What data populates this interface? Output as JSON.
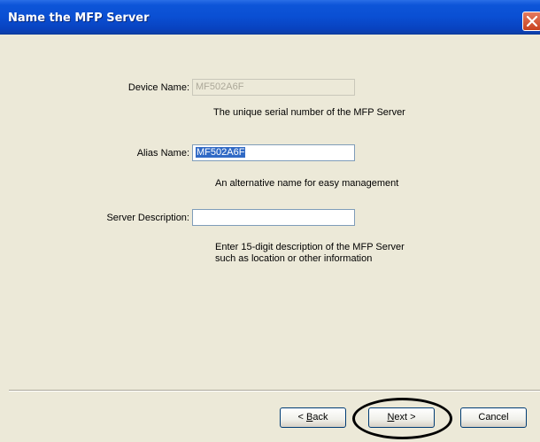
{
  "window": {
    "title": "Name the MFP Server",
    "close_icon": "close-icon"
  },
  "form": {
    "device_name": {
      "label": "Device Name:",
      "value": "MF502A6F",
      "hint": "The unique serial number of the MFP Server"
    },
    "alias_name": {
      "label": "Alias Name:",
      "value": "MF502A6F",
      "hint": "An alternative name for easy management"
    },
    "server_description": {
      "label": "Server Description:",
      "value": "",
      "hint_line1": "Enter 15-digit description of the MFP Server",
      "hint_line2": "such as location or other information"
    }
  },
  "buttons": {
    "back_prefix": "< ",
    "back_key": "B",
    "back_rest": "ack",
    "next_key": "N",
    "next_rest": "ext >",
    "cancel": "Cancel"
  },
  "colors": {
    "titlebar": "#0a4fd3",
    "dialog_bg": "#ece9d8",
    "selection": "#316ac5",
    "highlight_ring": "#000000"
  }
}
